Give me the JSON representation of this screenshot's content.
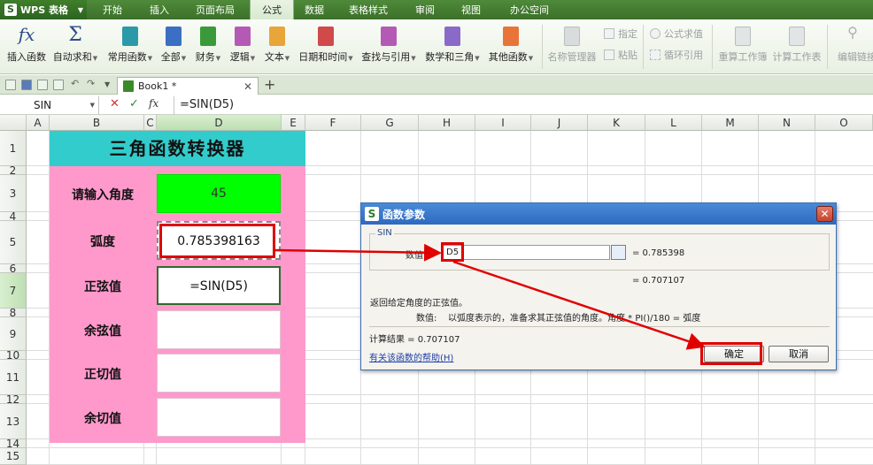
{
  "menubar": {
    "app_name": "WPS 表格",
    "logo": "S",
    "items": [
      "开始",
      "插入",
      "页面布局",
      "公式",
      "数据",
      "表格样式",
      "审阅",
      "视图",
      "办公空间"
    ],
    "active": "公式"
  },
  "ribbon": {
    "insert_function": "插入函数",
    "autosum": "自动求和",
    "common": "常用函数",
    "all": "全部",
    "finance": "财务",
    "logic": "逻辑",
    "text": "文本",
    "datetime": "日期和时间",
    "lookup": "查找与引用",
    "math": "数学和三角",
    "other": "其他函数",
    "name_manager": "名称管理器",
    "assign": "指定",
    "paste": "粘贴",
    "formula_eval": "公式求值",
    "circular": "循环引用",
    "recalc_workbook": "重算工作簿",
    "calc_sheet": "计算工作表",
    "edit_links": "编辑链接"
  },
  "tabs": {
    "doc_title": "Book1 *"
  },
  "formula_bar": {
    "name_box": "SIN",
    "formula": "=SIN(D5)"
  },
  "columns": [
    "A",
    "B",
    "C",
    "D",
    "E",
    "F",
    "G",
    "H",
    "I",
    "J",
    "K",
    "L",
    "M",
    "N",
    "O"
  ],
  "rows": [
    "1",
    "2",
    "3",
    "4",
    "5",
    "6",
    "7",
    "8",
    "9",
    "10",
    "11",
    "12",
    "13",
    "14",
    "15"
  ],
  "sheet": {
    "title": "三角函数转换器",
    "rows": [
      {
        "label": "请输入角度",
        "value": "45"
      },
      {
        "label": "弧度",
        "value": "0.785398163"
      },
      {
        "label": "正弦值",
        "value": "=SIN(D5)"
      },
      {
        "label": "余弦值",
        "value": ""
      },
      {
        "label": "正切值",
        "value": ""
      },
      {
        "label": "余切值",
        "value": ""
      }
    ]
  },
  "dialog": {
    "title": "函数参数",
    "group": "SIN",
    "arg_label": "数值",
    "arg_value": "D5",
    "arg_result": "= 0.785398",
    "result": "= 0.707107",
    "description": "返回给定角度的正弦值。",
    "param_name": "数值:",
    "param_desc": "以弧度表示的，准备求其正弦值的角度。角度 * PI()/180 = 弧度",
    "calc_result": "计算结果 = 0.707107",
    "help_link": "有关该函数的帮助(H)",
    "ok": "确定",
    "cancel": "取消"
  },
  "colors": {
    "title_bar": "#33cccc",
    "card": "#ff99cc",
    "input_green": "#00ff00",
    "highlight_red": "#e00000"
  }
}
